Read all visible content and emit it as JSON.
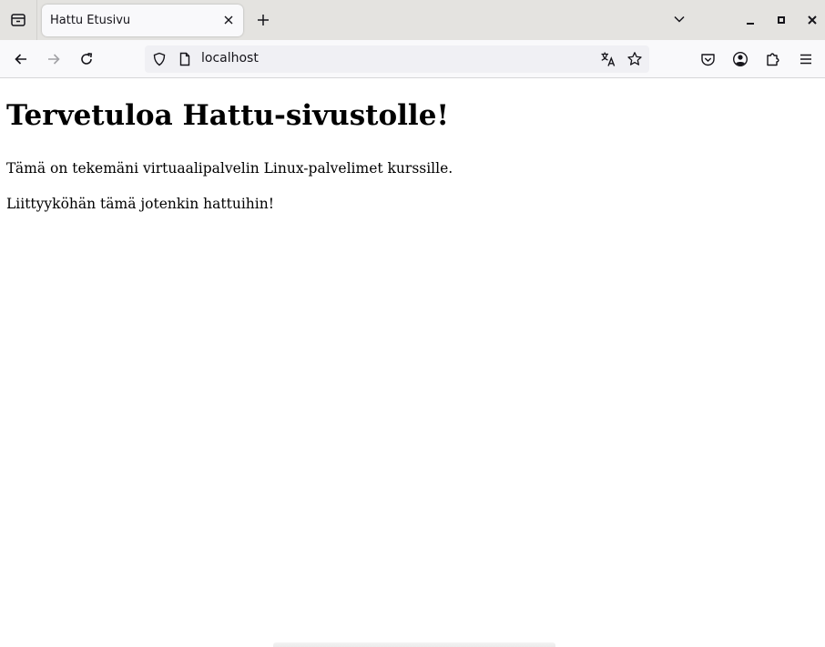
{
  "browser": {
    "tab": {
      "title": "Hattu Etusivu"
    },
    "url": "localhost"
  },
  "page": {
    "heading": "Tervetuloa Hattu-sivustolle!",
    "paragraphs": [
      "Tämä on tekemäni virtuaalipalvelin Linux-palvelimet kurssille.",
      "Liittyyköhän tämä jotenkin hattuihin!"
    ]
  },
  "icons": {
    "tab_list": "tab-list-icon",
    "tab_close": "close-icon",
    "new_tab": "plus-icon",
    "tab_overflow": "chevron-down-icon",
    "minimize": "minimize-icon",
    "maximize": "maximize-icon",
    "window_close": "close-icon",
    "back": "arrow-left-icon",
    "forward": "arrow-right-icon",
    "reload": "reload-icon",
    "shield": "shield-icon",
    "page": "page-icon",
    "translate": "translate-icon",
    "bookmark": "star-icon",
    "pocket": "pocket-icon",
    "account": "account-icon",
    "extensions": "puzzle-icon",
    "menu": "hamburger-menu-icon"
  },
  "colors": {
    "tabstrip": "#e4e3e0",
    "toolbar": "#f9f9fb",
    "urlbar": "#f0f0f4",
    "icon": "#15141a",
    "icon_disabled": "#a2a2a6"
  }
}
